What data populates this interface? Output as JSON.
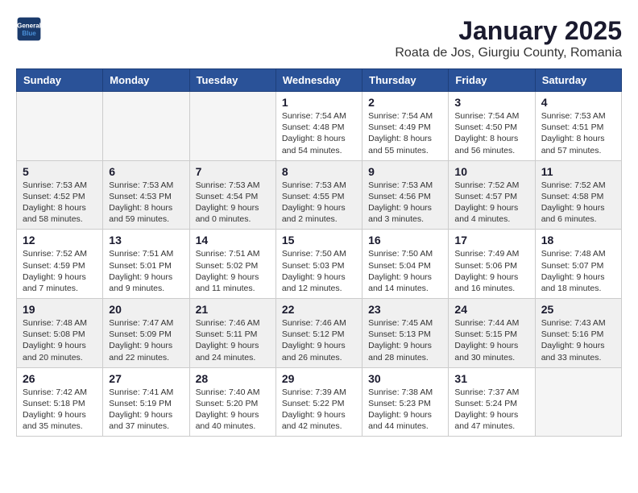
{
  "logo": {
    "line1": "General",
    "line2": "Blue"
  },
  "title": "January 2025",
  "subtitle": "Roata de Jos, Giurgiu County, Romania",
  "headers": [
    "Sunday",
    "Monday",
    "Tuesday",
    "Wednesday",
    "Thursday",
    "Friday",
    "Saturday"
  ],
  "weeks": [
    {
      "shaded": false,
      "days": [
        {
          "num": "",
          "info": ""
        },
        {
          "num": "",
          "info": ""
        },
        {
          "num": "",
          "info": ""
        },
        {
          "num": "1",
          "info": "Sunrise: 7:54 AM\nSunset: 4:48 PM\nDaylight: 8 hours\nand 54 minutes."
        },
        {
          "num": "2",
          "info": "Sunrise: 7:54 AM\nSunset: 4:49 PM\nDaylight: 8 hours\nand 55 minutes."
        },
        {
          "num": "3",
          "info": "Sunrise: 7:54 AM\nSunset: 4:50 PM\nDaylight: 8 hours\nand 56 minutes."
        },
        {
          "num": "4",
          "info": "Sunrise: 7:53 AM\nSunset: 4:51 PM\nDaylight: 8 hours\nand 57 minutes."
        }
      ]
    },
    {
      "shaded": true,
      "days": [
        {
          "num": "5",
          "info": "Sunrise: 7:53 AM\nSunset: 4:52 PM\nDaylight: 8 hours\nand 58 minutes."
        },
        {
          "num": "6",
          "info": "Sunrise: 7:53 AM\nSunset: 4:53 PM\nDaylight: 8 hours\nand 59 minutes."
        },
        {
          "num": "7",
          "info": "Sunrise: 7:53 AM\nSunset: 4:54 PM\nDaylight: 9 hours\nand 0 minutes."
        },
        {
          "num": "8",
          "info": "Sunrise: 7:53 AM\nSunset: 4:55 PM\nDaylight: 9 hours\nand 2 minutes."
        },
        {
          "num": "9",
          "info": "Sunrise: 7:53 AM\nSunset: 4:56 PM\nDaylight: 9 hours\nand 3 minutes."
        },
        {
          "num": "10",
          "info": "Sunrise: 7:52 AM\nSunset: 4:57 PM\nDaylight: 9 hours\nand 4 minutes."
        },
        {
          "num": "11",
          "info": "Sunrise: 7:52 AM\nSunset: 4:58 PM\nDaylight: 9 hours\nand 6 minutes."
        }
      ]
    },
    {
      "shaded": false,
      "days": [
        {
          "num": "12",
          "info": "Sunrise: 7:52 AM\nSunset: 4:59 PM\nDaylight: 9 hours\nand 7 minutes."
        },
        {
          "num": "13",
          "info": "Sunrise: 7:51 AM\nSunset: 5:01 PM\nDaylight: 9 hours\nand 9 minutes."
        },
        {
          "num": "14",
          "info": "Sunrise: 7:51 AM\nSunset: 5:02 PM\nDaylight: 9 hours\nand 11 minutes."
        },
        {
          "num": "15",
          "info": "Sunrise: 7:50 AM\nSunset: 5:03 PM\nDaylight: 9 hours\nand 12 minutes."
        },
        {
          "num": "16",
          "info": "Sunrise: 7:50 AM\nSunset: 5:04 PM\nDaylight: 9 hours\nand 14 minutes."
        },
        {
          "num": "17",
          "info": "Sunrise: 7:49 AM\nSunset: 5:06 PM\nDaylight: 9 hours\nand 16 minutes."
        },
        {
          "num": "18",
          "info": "Sunrise: 7:48 AM\nSunset: 5:07 PM\nDaylight: 9 hours\nand 18 minutes."
        }
      ]
    },
    {
      "shaded": true,
      "days": [
        {
          "num": "19",
          "info": "Sunrise: 7:48 AM\nSunset: 5:08 PM\nDaylight: 9 hours\nand 20 minutes."
        },
        {
          "num": "20",
          "info": "Sunrise: 7:47 AM\nSunset: 5:09 PM\nDaylight: 9 hours\nand 22 minutes."
        },
        {
          "num": "21",
          "info": "Sunrise: 7:46 AM\nSunset: 5:11 PM\nDaylight: 9 hours\nand 24 minutes."
        },
        {
          "num": "22",
          "info": "Sunrise: 7:46 AM\nSunset: 5:12 PM\nDaylight: 9 hours\nand 26 minutes."
        },
        {
          "num": "23",
          "info": "Sunrise: 7:45 AM\nSunset: 5:13 PM\nDaylight: 9 hours\nand 28 minutes."
        },
        {
          "num": "24",
          "info": "Sunrise: 7:44 AM\nSunset: 5:15 PM\nDaylight: 9 hours\nand 30 minutes."
        },
        {
          "num": "25",
          "info": "Sunrise: 7:43 AM\nSunset: 5:16 PM\nDaylight: 9 hours\nand 33 minutes."
        }
      ]
    },
    {
      "shaded": false,
      "days": [
        {
          "num": "26",
          "info": "Sunrise: 7:42 AM\nSunset: 5:18 PM\nDaylight: 9 hours\nand 35 minutes."
        },
        {
          "num": "27",
          "info": "Sunrise: 7:41 AM\nSunset: 5:19 PM\nDaylight: 9 hours\nand 37 minutes."
        },
        {
          "num": "28",
          "info": "Sunrise: 7:40 AM\nSunset: 5:20 PM\nDaylight: 9 hours\nand 40 minutes."
        },
        {
          "num": "29",
          "info": "Sunrise: 7:39 AM\nSunset: 5:22 PM\nDaylight: 9 hours\nand 42 minutes."
        },
        {
          "num": "30",
          "info": "Sunrise: 7:38 AM\nSunset: 5:23 PM\nDaylight: 9 hours\nand 44 minutes."
        },
        {
          "num": "31",
          "info": "Sunrise: 7:37 AM\nSunset: 5:24 PM\nDaylight: 9 hours\nand 47 minutes."
        },
        {
          "num": "",
          "info": ""
        }
      ]
    }
  ]
}
